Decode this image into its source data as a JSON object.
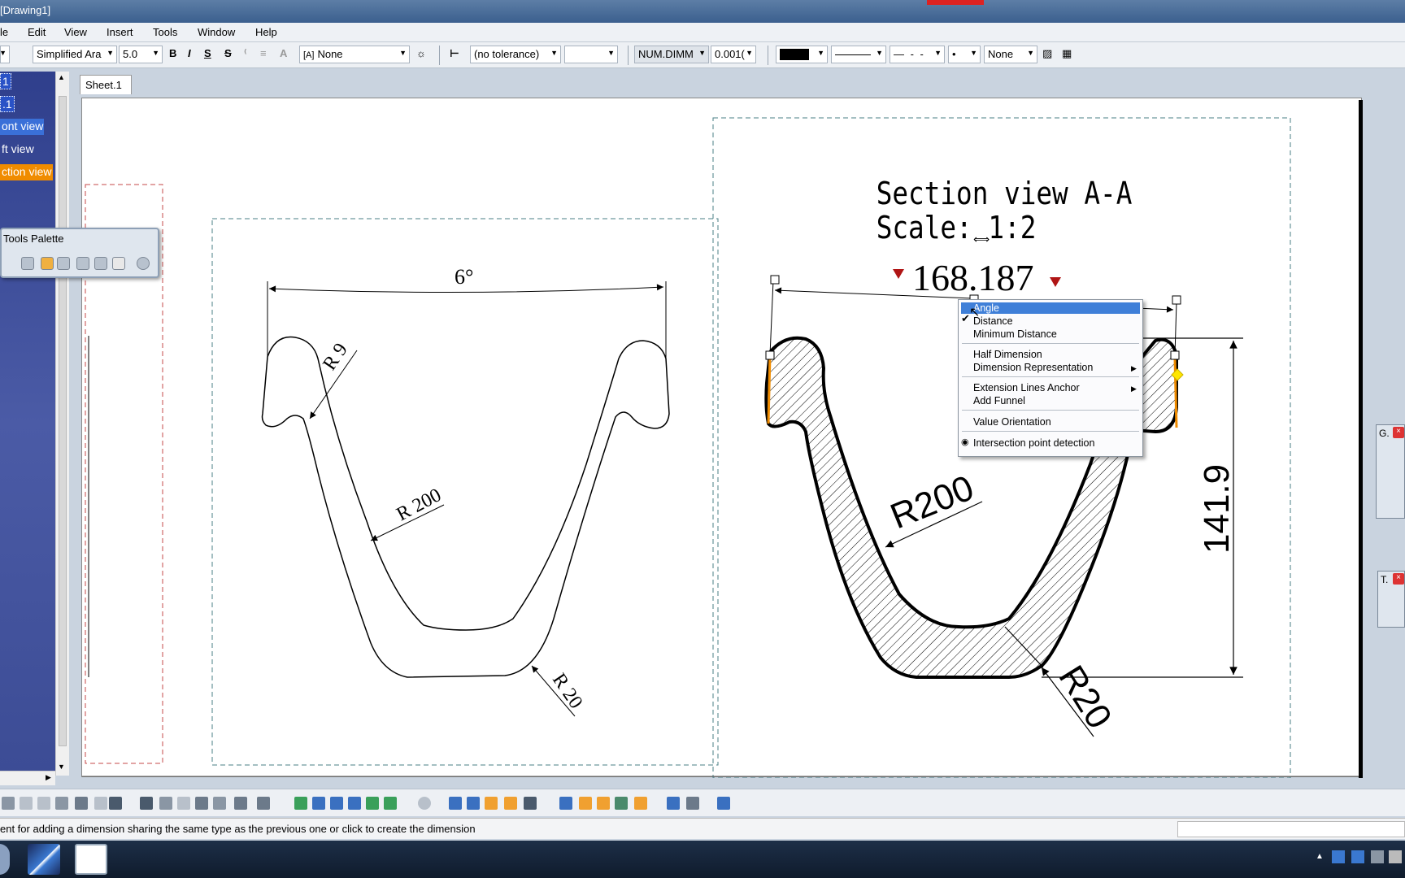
{
  "window": {
    "title": "[Drawing1]"
  },
  "menu": [
    "le",
    "Edit",
    "View",
    "Insert",
    "Tools",
    "Window",
    "Help"
  ],
  "toolbar": {
    "font_name": "Simplified Ara",
    "font_size": "5.0",
    "bold": "B",
    "italic": "I",
    "underline": "S",
    "strike": "S",
    "frame": "None",
    "tolerance": "(no tolerance)",
    "tolerance_value": "",
    "numeric_format": "NUM.DIMM",
    "precision": "0.001(",
    "line_end": "None"
  },
  "tree": {
    "items": [
      {
        "label": "1",
        "style": "selected-blue"
      },
      {
        "label": ".1",
        "style": "selected-blue"
      },
      {
        "label": "ont view",
        "style": "highlight-blue"
      },
      {
        "label": "ft view",
        "style": "normal"
      },
      {
        "label": "ction view",
        "style": "orange"
      }
    ]
  },
  "sheet_tab": "Sheet.1",
  "palette": {
    "title": "Tools Palette"
  },
  "drawing": {
    "left_view": {
      "angle_label": "6°",
      "radius_small": "R 9",
      "radius_large": "R 200",
      "radius_bottom": "R 20"
    },
    "section_view": {
      "title": "Section view A-A",
      "scale": "Scale:  1:2",
      "dimension_value": "168.187",
      "radius_large": "R200",
      "radius_bottom": "R20",
      "height_dim": "141.9"
    }
  },
  "context_menu": {
    "items": [
      {
        "label": "Angle",
        "selected": true
      },
      {
        "label": "Distance",
        "checked": true
      },
      {
        "label": "Minimum Distance"
      },
      {
        "label": "Half Dimension"
      },
      {
        "label": "Dimension Representation",
        "submenu": true
      },
      {
        "label": "Extension Lines Anchor",
        "submenu": true
      },
      {
        "label": "Add Funnel"
      },
      {
        "label": "Value Orientation"
      },
      {
        "label": "Intersection point detection",
        "radio": true
      }
    ]
  },
  "right_panels": [
    {
      "label": "G."
    },
    {
      "label": "T."
    }
  ],
  "status": {
    "message": "ent for adding a dimension sharing the same type as the previous one or click to create the dimension"
  },
  "colors": {
    "selection": "#3f7fd8",
    "tree_bg": "#3c4c95",
    "orange": "#f08c00",
    "dim_arrow": "#b01515"
  }
}
